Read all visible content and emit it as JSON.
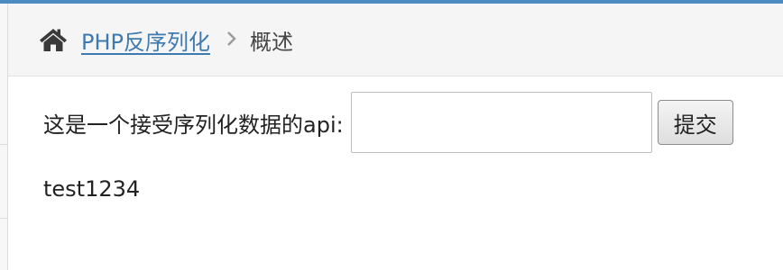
{
  "colors": {
    "accent": "#4a8cc1",
    "link": "#3d7ab0",
    "breadcrumb_bg": "#f5f5f5"
  },
  "breadcrumb": {
    "home_icon": "home-icon",
    "link_label": "PHP反序列化",
    "separator_icon": "chevron-right-icon",
    "current_label": "概述"
  },
  "form": {
    "label": "这是一个接受序列化数据的api:",
    "input_value": "",
    "submit_label": "提交"
  },
  "result": {
    "text": "test1234"
  }
}
